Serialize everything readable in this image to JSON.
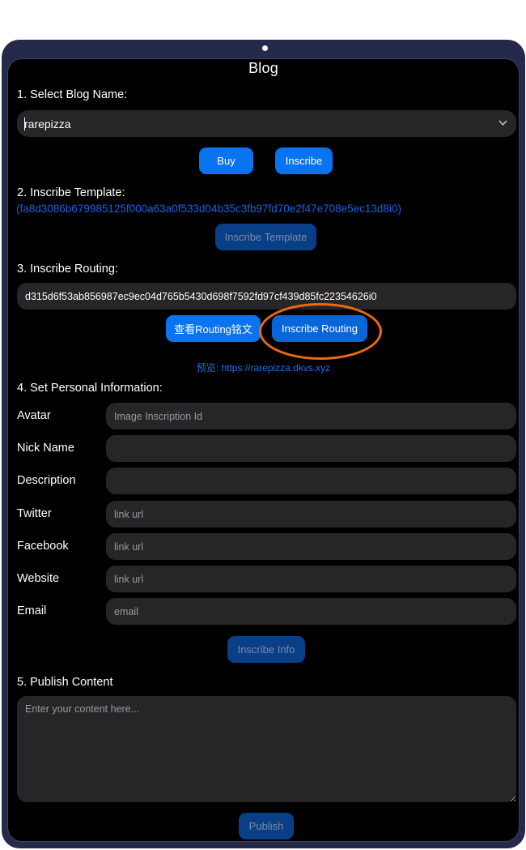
{
  "app": {
    "title": "Blog"
  },
  "step1": {
    "label": "1. Select Blog Name:",
    "selected_value": "rarepizza",
    "chevron_icon": "chevron-down",
    "buy_label": "Buy",
    "inscribe_label": "Inscribe"
  },
  "step2": {
    "label": "2. Inscribe Template:",
    "template_id": "(fa8d3086b679985125f000a63a0f533d04b35c3fb97fd70e2f47e708e5ec13d8i0)",
    "button_label": "Inscribe Template"
  },
  "step3": {
    "label": "3. Inscribe Routing:",
    "routing_value": "d315d6f53ab856987ec9ec04d765b5430d698f7592fd97cf439d85fc22354626i0",
    "view_button_label": "查看Routing铭文",
    "inscribe_button_label": "Inscribe Routing",
    "preview_text": "预览: https://rarepizza.dkvs.xyz"
  },
  "step4": {
    "label": "4. Set Personal Information:",
    "fields": [
      {
        "label": "Avatar",
        "placeholder": "Image Inscription Id",
        "value": ""
      },
      {
        "label": "Nick Name",
        "placeholder": "",
        "value": ""
      },
      {
        "label": "Description",
        "placeholder": "",
        "value": ""
      },
      {
        "label": "Twitter",
        "placeholder": "link url",
        "value": ""
      },
      {
        "label": "Facebook",
        "placeholder": "link url",
        "value": ""
      },
      {
        "label": "Website",
        "placeholder": "link url",
        "value": ""
      },
      {
        "label": "Email",
        "placeholder": "email",
        "value": ""
      }
    ],
    "button_label": "Inscribe Info"
  },
  "step5": {
    "label": "5. Publish Content",
    "placeholder": "Enter your content here...",
    "button_label": "Publish"
  },
  "colors": {
    "accent": "#0a74f0",
    "disabled_button": "#083f86",
    "link": "#1c5fe0",
    "highlight": "#f0680e",
    "device_frame": "#242a49",
    "input_bg": "#262628"
  }
}
